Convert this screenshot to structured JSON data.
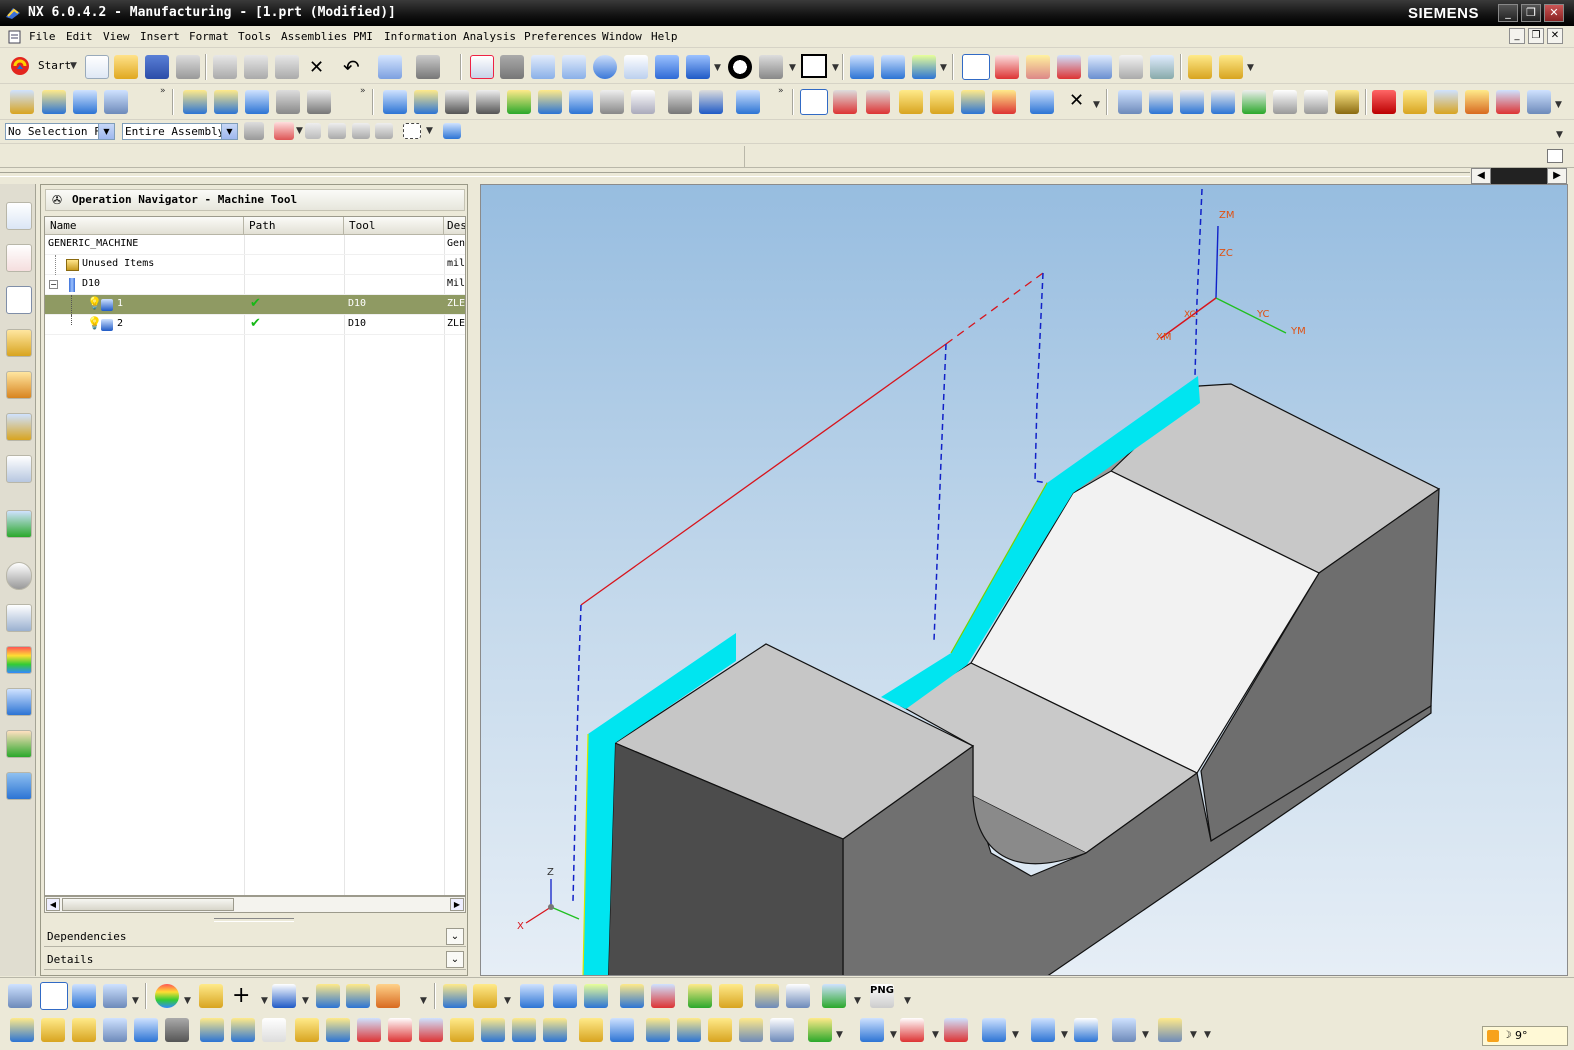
{
  "window": {
    "title": "NX 6.0.4.2 - Manufacturing - [1.prt (Modified)]",
    "brand": "SIEMENS",
    "controls": [
      "_",
      "❐",
      "✕"
    ]
  },
  "menu": {
    "items": [
      "File",
      "Edit",
      "View",
      "Insert",
      "Format",
      "Tools",
      "Assemblies",
      "PMI",
      "Information",
      "Analysis",
      "Preferences",
      "Window",
      "Help"
    ]
  },
  "toolbar": {
    "start_label": "Start",
    "selection_filter": "No Selection Fi",
    "scope": "Entire Assembly"
  },
  "navigator": {
    "title": "Operation Navigator - Machine Tool",
    "columns": [
      "Name",
      "Path",
      "Tool",
      "Des"
    ],
    "rows": [
      {
        "name": "GENERIC_MACHINE",
        "path": "",
        "tool": "",
        "desc": "Gen"
      },
      {
        "name": "Unused Items",
        "path": "",
        "tool": "",
        "desc": "mill"
      },
      {
        "name": "D10",
        "path": "",
        "tool": "",
        "desc": "Mill"
      },
      {
        "name": "1",
        "path": "✔",
        "tool": "D10",
        "desc": "ZLE"
      },
      {
        "name": "2",
        "path": "✔",
        "tool": "D10",
        "desc": "ZLE"
      }
    ],
    "dependencies_label": "Dependencies",
    "details_label": "Details"
  },
  "viewport": {
    "axis_labels": {
      "zm": "ZM",
      "zc": "ZC",
      "yc": "YC",
      "ym": "YM",
      "xc": "XC",
      "xm": "XM",
      "z": "Z",
      "x": "X"
    }
  },
  "colors": {
    "accent_cyan": "#00e5f0",
    "selected_row": "#8f9a63",
    "path_red": "#d8141c",
    "path_blue": "#1020c8"
  },
  "tray": {
    "text": "9°"
  }
}
